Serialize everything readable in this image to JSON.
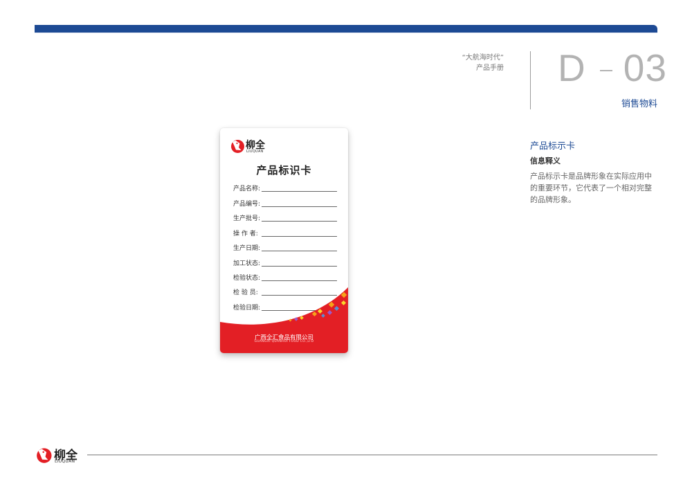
{
  "header": {
    "manual_title": "“大航海时代”",
    "manual_subtitle": "产品手册",
    "section_letter": "D",
    "section_number": "03",
    "section_name": "销售物料",
    "bar_color": "#1d4a94"
  },
  "card": {
    "logo_cn": "柳全",
    "logo_en": "LIUQUAN",
    "title": "产品标识卡",
    "fields": [
      {
        "label": "产品名称:"
      },
      {
        "label": "产品编号:"
      },
      {
        "label": "生产批号:"
      },
      {
        "label": "操  作  者:"
      },
      {
        "label": "生产日期:"
      },
      {
        "label": "加工状态:"
      },
      {
        "label": "检验状态:"
      },
      {
        "label": "检  验  员:"
      },
      {
        "label": "检验日期:"
      }
    ],
    "company_cn": "广西全汇食品有限公司",
    "company_en": "GUANGXI QUANHUI FOOD CO.,LTD",
    "accent_color": "#e31f25"
  },
  "info": {
    "title": "产品标示卡",
    "subtitle": "信息释义",
    "body": "产品标示卡是品牌形象在实际应用中的重要环节，它代表了一个相对完整的品牌形象。"
  },
  "footer": {
    "logo_cn": "柳全",
    "logo_en": "LIUQUAN"
  }
}
